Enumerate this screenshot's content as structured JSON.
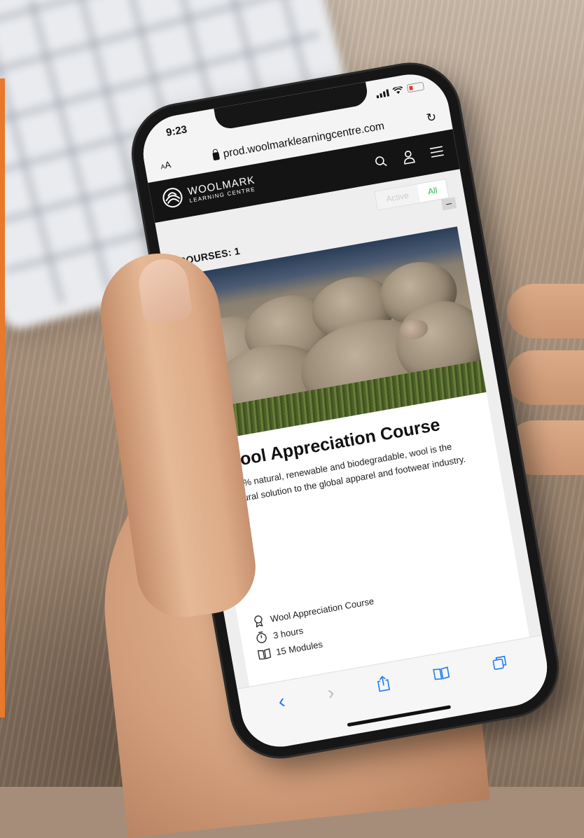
{
  "status": {
    "time": "9:23"
  },
  "browser": {
    "text_size_label_small": "A",
    "text_size_label_large": "A",
    "url": "prod.woolmarklearningcentre.com"
  },
  "site": {
    "logo_line1": "WOOLMARK",
    "logo_line2": "LEARNING CENTRE",
    "filter": {
      "active_label": "Active",
      "all_label": "All",
      "selected": "All"
    },
    "courses_count": "COURSES: 1",
    "collapse_label": "–"
  },
  "course": {
    "title": "Wool Appreciation Course",
    "description": "100% natural, renewable and biodegradable, wool is the natural solution to the global apparel and footwear industry.",
    "certificate": "Wool Appreciation Course",
    "duration": "3 hours",
    "modules": "15 Modules"
  },
  "colors": {
    "accent_green": "#2fb84a",
    "safari_blue": "#1e7cf2",
    "brand_orange": "#e8782a",
    "header_black": "#141414"
  },
  "icons": {
    "search": "search-icon",
    "account": "user-icon",
    "menu": "hamburger-menu-icon",
    "certificate": "award-ribbon-icon",
    "duration": "stopwatch-icon",
    "modules": "open-book-icon",
    "share": "share-icon",
    "bookmarks": "bookmarks-icon",
    "tabs": "tabs-icon"
  }
}
